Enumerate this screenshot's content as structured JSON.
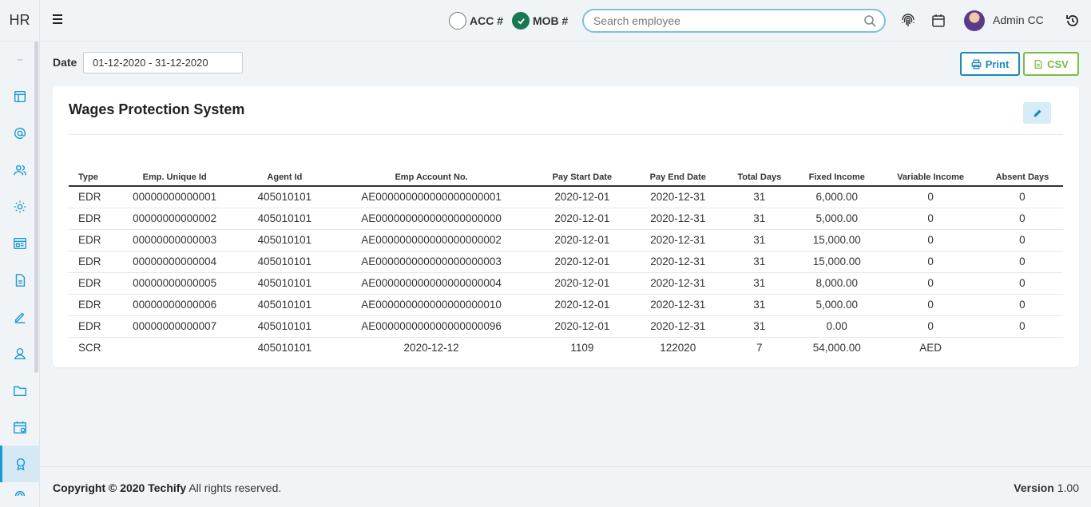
{
  "app": {
    "logo": "HR"
  },
  "header": {
    "acc_label": "ACC #",
    "mob_label": "MOB #",
    "search_placeholder": "Search employee",
    "user_name": "Admin CC"
  },
  "sidebar": {
    "items": [
      {
        "icon": "logo-mini-icon"
      },
      {
        "icon": "layout-icon"
      },
      {
        "icon": "at-icon"
      },
      {
        "icon": "users-icon"
      },
      {
        "icon": "settings-icon"
      },
      {
        "icon": "dashboard-icon"
      },
      {
        "icon": "document-icon"
      },
      {
        "icon": "edit-icon"
      },
      {
        "icon": "user-icon"
      },
      {
        "icon": "folder-icon"
      },
      {
        "icon": "calendar-icon"
      },
      {
        "icon": "award-icon",
        "active": true
      },
      {
        "icon": "fingerprint-icon"
      }
    ]
  },
  "toolbar": {
    "date_label": "Date",
    "date_value": "01-12-2020 - 31-12-2020",
    "print_label": "Print",
    "csv_label": "CSV"
  },
  "card": {
    "title": "Wages Protection System"
  },
  "table": {
    "headers": [
      "Type",
      "Emp. Unique Id",
      "Agent Id",
      "Emp Account No.",
      "Pay Start Date",
      "Pay End Date",
      "Total Days",
      "Fixed Income",
      "Variable Income",
      "Absent Days"
    ],
    "rows": [
      [
        "EDR",
        "00000000000001",
        "405010101",
        "AE000000000000000000001",
        "2020-12-01",
        "2020-12-31",
        "31",
        "6,000.00",
        "0",
        "0"
      ],
      [
        "EDR",
        "00000000000002",
        "405010101",
        "AE000000000000000000000",
        "2020-12-01",
        "2020-12-31",
        "31",
        "5,000.00",
        "0",
        "0"
      ],
      [
        "EDR",
        "00000000000003",
        "405010101",
        "AE000000000000000000002",
        "2020-12-01",
        "2020-12-31",
        "31",
        "15,000.00",
        "0",
        "0"
      ],
      [
        "EDR",
        "00000000000004",
        "405010101",
        "AE000000000000000000003",
        "2020-12-01",
        "2020-12-31",
        "31",
        "15,000.00",
        "0",
        "0"
      ],
      [
        "EDR",
        "00000000000005",
        "405010101",
        "AE000000000000000000004",
        "2020-12-01",
        "2020-12-31",
        "31",
        "8,000.00",
        "0",
        "0"
      ],
      [
        "EDR",
        "00000000000006",
        "405010101",
        "AE000000000000000000010",
        "2020-12-01",
        "2020-12-31",
        "31",
        "5,000.00",
        "0",
        "0"
      ],
      [
        "EDR",
        "00000000000007",
        "405010101",
        "AE000000000000000000096",
        "2020-12-01",
        "2020-12-31",
        "31",
        "0.00",
        "0",
        "0"
      ],
      [
        "SCR",
        "",
        "405010101",
        "2020-12-12",
        "1109",
        "122020",
        "7",
        "54,000.00",
        "AED",
        ""
      ]
    ]
  },
  "footer": {
    "copyright_bold": "Copyright © 2020 Techify",
    "copyright_rest": " All rights reserved.",
    "version_label": "Version",
    "version_value": " 1.00"
  }
}
